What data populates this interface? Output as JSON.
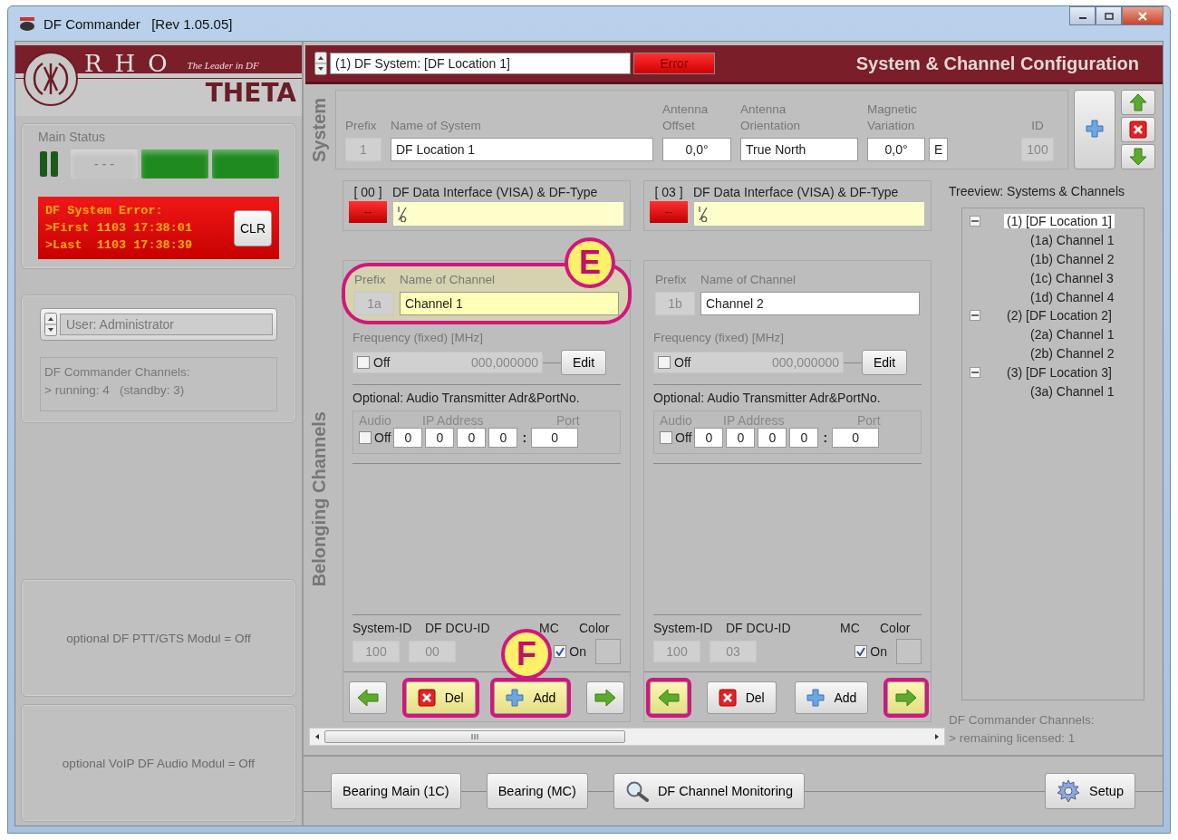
{
  "window": {
    "title": "DF Commander   [Rev 1.05.05]"
  },
  "logo": {
    "word_top": "RHO",
    "word_bottom": "THETA",
    "tagline": "The Leader in DF"
  },
  "main_status": {
    "label": "Main Status",
    "lamps": [
      {
        "kind": "pair",
        "color": "#1c5a1c"
      },
      {
        "kind": "bar",
        "color": "#c4c4c4",
        "text": "- - -"
      },
      {
        "kind": "bar",
        "color": "#1f8a1f"
      },
      {
        "kind": "bar",
        "color": "#1f8a1f"
      }
    ]
  },
  "error_box": {
    "lines": [
      "DF System Error:",
      ">First 1103 17:38:01",
      ">Last  1103 17:38:39"
    ],
    "clear_button": "CLR"
  },
  "user_selector": {
    "value": "User: Administrator"
  },
  "channel_info": {
    "lines": [
      "DF Commander Channels:",
      "> running: 4   (standby: 3)"
    ]
  },
  "modules": [
    "optional DF PTT/GTS Modul = Off",
    "optional VoIP DF Audio Modul = Off"
  ],
  "header": {
    "system_selector": "(1) DF System: [DF Location 1]",
    "status": "Error",
    "title": "System & Channel Configuration"
  },
  "system": {
    "section_label": "System",
    "prefix_label": "Prefix",
    "prefix": "1",
    "name_label": "Name of System",
    "name": "DF Location 1",
    "offset_label": "Antenna Offset",
    "offset": "0,0°",
    "orientation_label": "Antenna Orientation",
    "orientation": "True North",
    "variation_label": "Magnetic Variation",
    "variation": "0,0°",
    "variation_dir": "E",
    "id_label": "ID",
    "id": "100"
  },
  "channels_label": "Belonging Channels",
  "channels": [
    {
      "index": "[ 00 ]",
      "led": "--",
      "interface_label": "DF Data Interface (VISA) & DF-Type",
      "prefix_label": "Prefix",
      "name_label": "Name of Channel",
      "prefix": "1a",
      "name": "Channel 1",
      "name_highlighted": true,
      "callout": "E",
      "freq_label": "Frequency (fixed) [MHz]",
      "freq_checked": false,
      "freq_state": "Off",
      "freq_value": "000,000000",
      "edit_button": "Edit",
      "audio_title": "Optional: Audio Transmitter Adr&PortNo.",
      "audio_label": "Audio",
      "ip_label": "IP Address",
      "port_label": "Port",
      "audio_checked": false,
      "audio_state": "Off",
      "ip": [
        "0",
        "0",
        "0",
        "0"
      ],
      "ip_separator": ":",
      "port": "0",
      "sysid_label": "System-ID",
      "dcu_label": "DF DCU-ID",
      "mc_label": "MC",
      "color_label": "Color",
      "system_id": "100",
      "dcu_id": "00",
      "mc_checked": true,
      "mc_state": "On",
      "buttons_callout": "F",
      "buttons": [
        {
          "kind": "prev",
          "highlighted": false
        },
        {
          "kind": "del",
          "label": "Del",
          "highlighted": true
        },
        {
          "kind": "add",
          "label": "Add",
          "highlighted": true
        },
        {
          "kind": "next",
          "highlighted": false
        }
      ]
    },
    {
      "index": "[ 03 ]",
      "led": "--",
      "interface_label": "DF Data Interface (VISA) & DF-Type",
      "prefix_label": "Prefix",
      "name_label": "Name of Channel",
      "prefix": "1b",
      "name": "Channel 2",
      "name_highlighted": false,
      "freq_label": "Frequency (fixed) [MHz]",
      "freq_checked": false,
      "freq_state": "Off",
      "freq_value": "000,000000",
      "edit_button": "Edit",
      "audio_title": "Optional: Audio Transmitter Adr&PortNo.",
      "audio_label": "Audio",
      "ip_label": "IP Address",
      "port_label": "Port",
      "audio_checked": false,
      "audio_state": "Off",
      "ip": [
        "0",
        "0",
        "0",
        "0"
      ],
      "ip_separator": ":",
      "port": "0",
      "sysid_label": "System-ID",
      "dcu_label": "DF DCU-ID",
      "mc_label": "MC",
      "color_label": "Color",
      "system_id": "100",
      "dcu_id": "03",
      "mc_checked": true,
      "mc_state": "On",
      "buttons": [
        {
          "kind": "prev",
          "highlighted": true
        },
        {
          "kind": "del",
          "label": "Del",
          "highlighted": false
        },
        {
          "kind": "add",
          "label": "Add",
          "highlighted": false
        },
        {
          "kind": "next",
          "highlighted": true
        }
      ]
    }
  ],
  "tree": {
    "title": "Treeview: Systems & Channels",
    "items": [
      {
        "label": "(1) [DF Location 1]",
        "expanded": true,
        "selected": true,
        "children": [
          {
            "label": "(1a) Channel 1",
            "selected": false
          },
          {
            "label": "(1b) Channel 2",
            "selected": false
          },
          {
            "label": "(1c) Channel 3",
            "selected": false
          },
          {
            "label": "(1d) Channel 4",
            "selected": false
          }
        ]
      },
      {
        "label": "(2) [DF Location 2]",
        "expanded": true,
        "selected": false,
        "children": [
          {
            "label": "(2a) Channel 1",
            "selected": false
          },
          {
            "label": "(2b) Channel 2",
            "selected": false
          }
        ]
      },
      {
        "label": "(3) [DF Location 3]",
        "expanded": true,
        "selected": false,
        "children": [
          {
            "label": "(3a) Channel 1",
            "selected": false
          }
        ]
      }
    ]
  },
  "license_info": {
    "lines": [
      "DF Commander Channels:",
      "> remaining licensed: 1"
    ]
  },
  "bottom_buttons": [
    {
      "kind": "plain",
      "label": "Bearing Main (1C)"
    },
    {
      "kind": "plain",
      "label": "Bearing (MC)"
    },
    {
      "kind": "search",
      "label": "DF Channel Monitoring"
    },
    {
      "kind": "setup",
      "label": "Setup"
    }
  ]
}
